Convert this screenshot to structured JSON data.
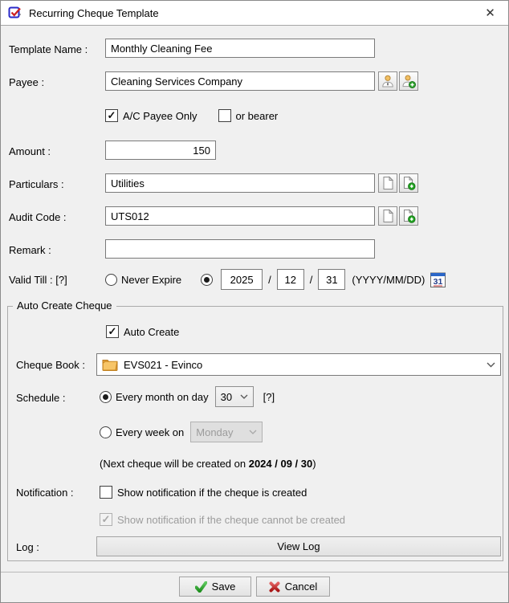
{
  "colors": {
    "dialog_bg": "#f0f0f0",
    "titlebar_bg": "#ffffff",
    "input_border": "#7a7a7a",
    "accent_green": "#2e9e2e",
    "accent_red": "#c42b2b",
    "folder_orange": "#f2b14a",
    "disabled_text": "#9c9c9c"
  },
  "window": {
    "title": "Recurring Cheque Template",
    "close_glyph": "✕"
  },
  "form": {
    "template_name": {
      "label": "Template Name :",
      "value": "Monthly Cleaning Fee"
    },
    "payee": {
      "label": "Payee :",
      "value": "Cleaning Services Company"
    },
    "payee_options": {
      "ac_payee_only": "A/C Payee Only",
      "or_bearer": "or bearer"
    },
    "amount": {
      "label": "Amount :",
      "value": "150"
    },
    "particulars": {
      "label": "Particulars :",
      "value": "Utilities"
    },
    "audit_code": {
      "label": "Audit Code :",
      "value": "UTS012"
    },
    "remark": {
      "label": "Remark :",
      "value": ""
    },
    "valid_till": {
      "label": "Valid Till :",
      "help": "[?]",
      "never_expire_label": "Never Expire",
      "year": "2025",
      "separator1": "/",
      "month": "12",
      "separator2": "/",
      "day": "31",
      "format_hint": "(YYYY/MM/DD)",
      "calendar_day": "31"
    }
  },
  "auto_create_group": {
    "title": "Auto Create Cheque",
    "auto_create_label": "Auto Create",
    "cheque_book": {
      "label": "Cheque Book :",
      "selected": "EVS021 - Evinco"
    },
    "schedule": {
      "label": "Schedule :",
      "monthly_label": "Every month on day",
      "monthly_day": "30",
      "help": "[?]",
      "weekly_label": "Every week on",
      "weekly_day": "Monday",
      "next_note_prefix": "(Next cheque will be created on ",
      "next_date": "2024 / 09 / 30",
      "next_note_suffix": ")"
    },
    "notification": {
      "label": "Notification :",
      "created_label": "Show notification if the cheque is created",
      "failed_label": "Show notification if the cheque cannot be created"
    },
    "log": {
      "label": "Log :",
      "view_log_label": "View Log"
    }
  },
  "footer": {
    "save_label": "Save",
    "cancel_label": "Cancel"
  }
}
